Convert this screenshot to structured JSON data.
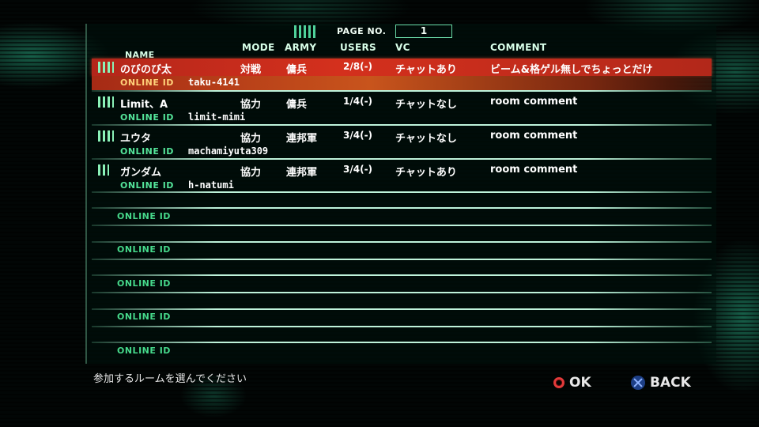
{
  "page": {
    "label": "PAGE NO.",
    "value": "1"
  },
  "headers": {
    "name": "NAME",
    "mode": "MODE",
    "army": "ARMY",
    "users": "USERS",
    "vc": "VC",
    "comment": "COMMENT"
  },
  "rooms": [
    {
      "name": "のびのび太",
      "mode": "対戦",
      "army": "傭兵",
      "users": "2/8(-)",
      "vc": "チャットあり",
      "comment": "ビーム&格ゲル無しでちょっとだけ",
      "online_id_label": "ONLINE ID",
      "online_id": "taku-4141",
      "selected": true
    },
    {
      "name": "Limit、A",
      "mode": "協力",
      "army": "傭兵",
      "users": "1/4(-)",
      "vc": "チャットなし",
      "comment": "room comment",
      "online_id_label": "ONLINE ID",
      "online_id": "limit-mimi",
      "selected": false
    },
    {
      "name": "ユウタ",
      "mode": "協力",
      "army": "連邦軍",
      "users": "3/4(-)",
      "vc": "チャットなし",
      "comment": "room comment",
      "online_id_label": "ONLINE ID",
      "online_id": "machamiyuta309",
      "selected": false
    },
    {
      "name": "ガンダム",
      "mode": "協力",
      "army": "連邦軍",
      "users": "3/4(-)",
      "vc": "チャットあり",
      "comment": "room comment",
      "online_id_label": "ONLINE ID",
      "online_id": "h-natumi",
      "selected": false
    }
  ],
  "empty_rows": [
    {
      "online_id_label": "ONLINE ID"
    },
    {
      "online_id_label": "ONLINE ID"
    },
    {
      "online_id_label": "ONLINE ID"
    },
    {
      "online_id_label": "ONLINE ID"
    },
    {
      "online_id_label": "ONLINE ID"
    }
  ],
  "footer": {
    "hint": "参加するルームを選んでください",
    "ok_label": "OK",
    "back_label": "BACK"
  },
  "colors": {
    "selected_row": "#d4301d",
    "accent_green": "#54e59a",
    "line": "#c8ffe6",
    "ok_circle": "#e23a3a",
    "back_cross": "#1d3f86"
  }
}
